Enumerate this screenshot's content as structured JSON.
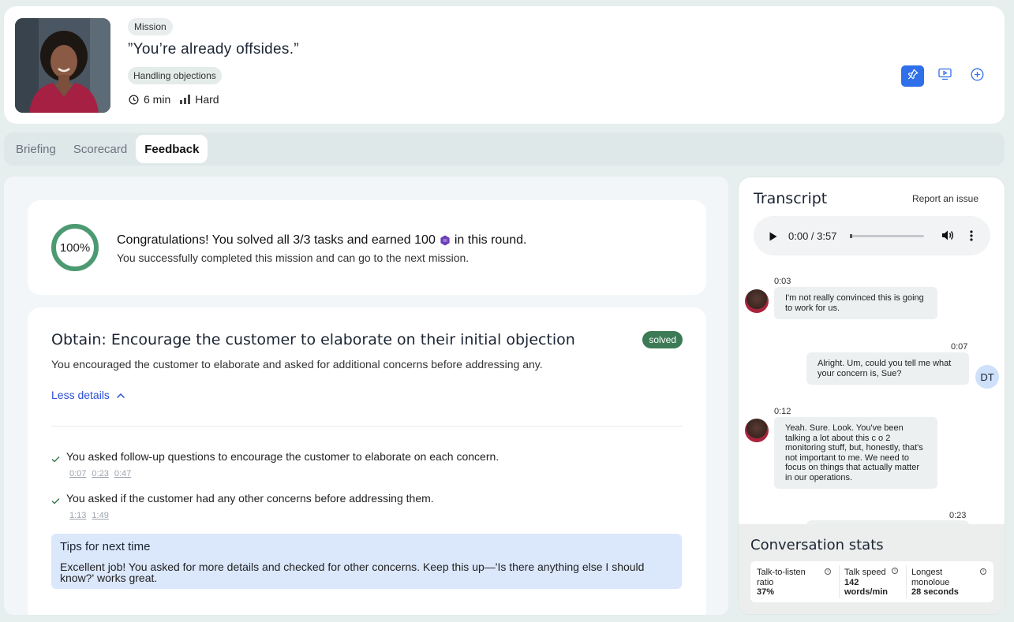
{
  "header": {
    "mission_badge": "Mission",
    "title": "”You’re already offsides.”",
    "category_badge": "Handling objections",
    "duration": "6 min",
    "difficulty": "Hard",
    "actions": [
      "pin-icon",
      "presentation-icon",
      "add-circle-icon"
    ]
  },
  "tabs": [
    {
      "label": "Briefing",
      "active": false
    },
    {
      "label": "Scorecard",
      "active": false
    },
    {
      "label": "Feedback",
      "active": true
    }
  ],
  "summary": {
    "progress": 1.0,
    "progress_label": "100%",
    "title_prefix": "Congratulations! You solved all 3/3 tasks and earned 100",
    "title_suffix": "in this round.",
    "subtitle": "You successfully completed this mission and can go to the next mission.",
    "progress_color": "#4c9a72"
  },
  "task": {
    "title": "Obtain: Encourage the customer to elaborate on their initial objection",
    "status": "solved",
    "description": "You encouraged the customer to elaborate and asked for additional concerns before addressing any.",
    "toggle_label": "Less details",
    "criteria": [
      {
        "text": "You asked follow-up questions to encourage the customer to elaborate on each concern.",
        "timestamps": [
          "0:07",
          "0:23",
          "0:47"
        ]
      },
      {
        "text": "You asked if the customer had any other concerns before addressing them.",
        "timestamps": [
          "1:13",
          "1:49"
        ]
      }
    ],
    "tips": {
      "title": "Tips for next time",
      "body": "Excellent job! You asked for more details and checked for other concerns. Keep this up—'Is there anything else I should know?' works great."
    }
  },
  "transcript": {
    "title": "Transcript",
    "report_label": "Report an issue",
    "audio": {
      "time": "0:00 / 3:57"
    },
    "messages": [
      {
        "speaker": "customer",
        "time": "0:03",
        "text": "I'm not really convinced this is going to work for us."
      },
      {
        "speaker": "user",
        "initials": "DT",
        "time": "0:07",
        "text": "Alright. Um, could you tell me what your concern is, Sue?"
      },
      {
        "speaker": "customer",
        "time": "0:12",
        "text": "Yeah. Sure. Look. You've been talking a lot about this c o 2 monitoring stuff, but, honestly, that's not important to me. We need to focus on things that actually matter in our operations."
      },
      {
        "speaker": "user",
        "time": "0:23",
        "text": ""
      }
    ]
  },
  "stats": {
    "title": "Conversation stats",
    "items": [
      {
        "label": "Talk-to-listen ratio",
        "value": "37%"
      },
      {
        "label": "Talk speed",
        "value": "142 words/min"
      },
      {
        "label": "Longest monoloue",
        "value": "28 seconds"
      }
    ]
  }
}
